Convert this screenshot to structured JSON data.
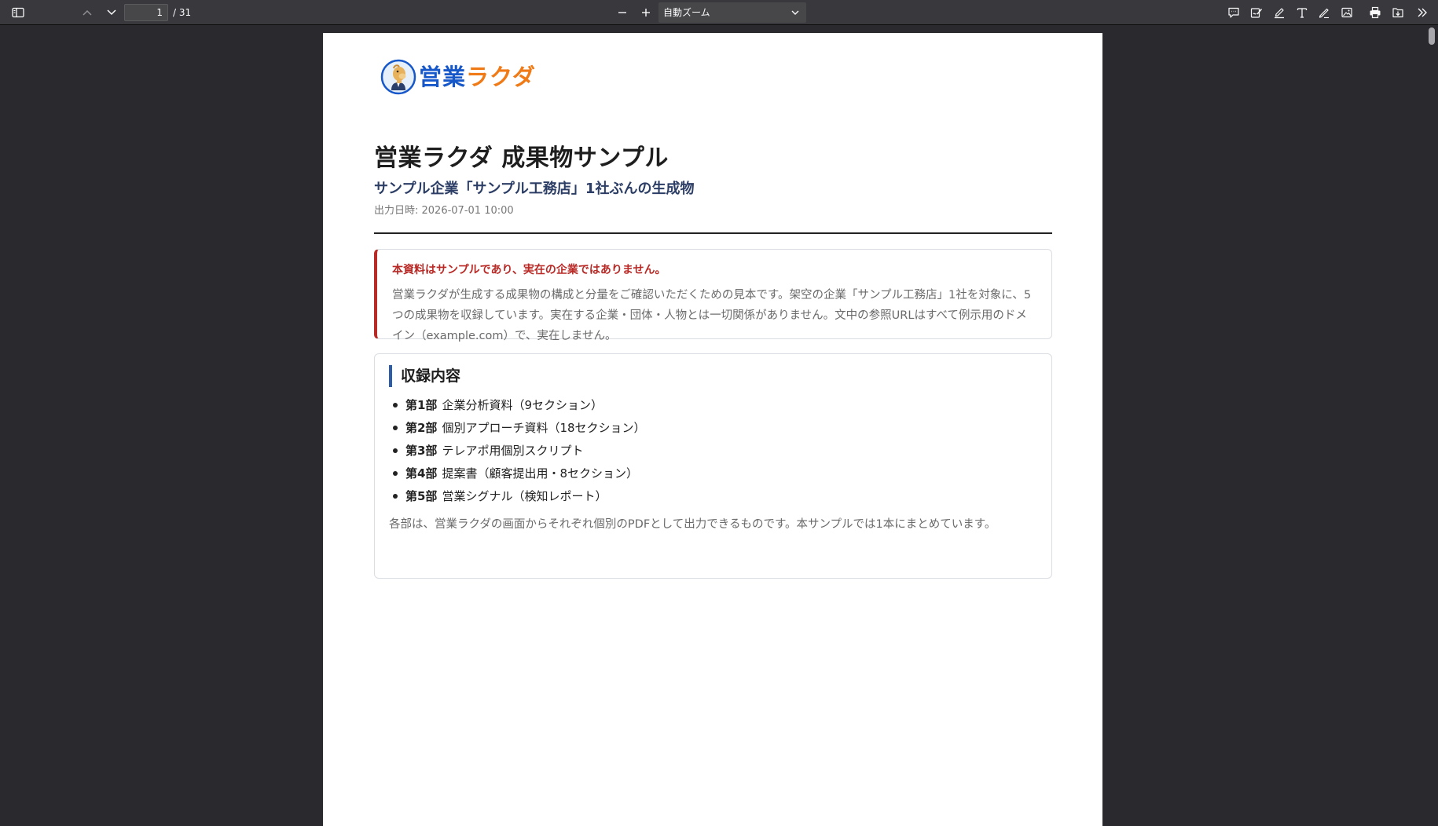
{
  "toolbar": {
    "page_number": "1",
    "page_count": "/ 31",
    "zoom_label": "自動ズーム",
    "icons": [
      "sidebar-toggle-icon",
      "previous-page-icon",
      "next-page-icon",
      "zoom-out-icon",
      "zoom-in-icon",
      "chevron-down-icon",
      "comment-icon",
      "signature-icon",
      "highlight-icon",
      "text-icon",
      "draw-icon",
      "image-icon",
      "print-icon",
      "save-icon",
      "tools-menu-icon"
    ]
  },
  "document": {
    "logo": {
      "text_blue": "営業",
      "text_orange": "ラクダ",
      "colors": {
        "blue": "#1657c9",
        "orange": "#f07a16"
      }
    },
    "title": "営業ラクダ 成果物サンプル",
    "subtitle": "サンプル企業「サンプル工務店」1社ぶんの生成物",
    "date": "出力日時: 2026-07-01 10:00",
    "notice": {
      "title": "本資料はサンプルであり、実在の企業ではありません。",
      "body": "営業ラクダが生成する成果物の構成と分量をご確認いただくための見本です。架空の企業「サンプル工務店」1社を対象に、5つの成果物を収録しています。実在する企業・団体・人物とは一切関係がありません。文中の参照URLはすべて例示用のドメイン（example.com）で、実在しません。",
      "accent_color": "#b92a26"
    },
    "contents": {
      "title": "収録内容",
      "items": [
        {
          "part": "第1部",
          "text": "企業分析資料（9セクション）"
        },
        {
          "part": "第2部",
          "text": "個別アプローチ資料（18セクション）"
        },
        {
          "part": "第3部",
          "text": "テレアポ用個別スクリプト"
        },
        {
          "part": "第4部",
          "text": "提案書（顧客提出用・8セクション）"
        },
        {
          "part": "第5部",
          "text": "営業シグナル（検知レポート）"
        }
      ],
      "note": "各部は、営業ラクダの画面からそれぞれ個別のPDFとして出力できるものです。本サンプルでは1本にまとめています。",
      "accent_color": "#2d5da8"
    }
  }
}
